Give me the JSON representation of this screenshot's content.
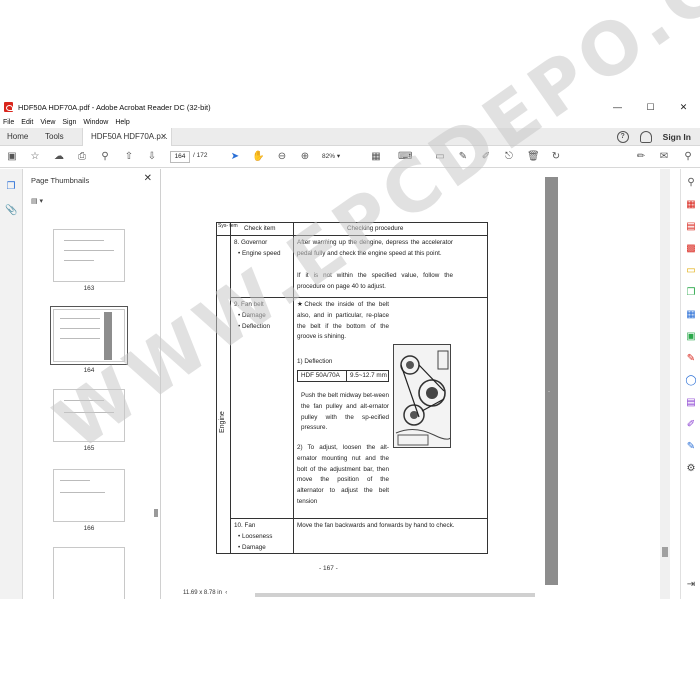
{
  "window": {
    "title": "HDF50A HDF70A.pdf - Adobe Acrobat Reader DC (32-bit)",
    "min": "—",
    "max": "☐",
    "close": "✕"
  },
  "menu": [
    "File",
    "Edit",
    "View",
    "Sign",
    "Window",
    "Help"
  ],
  "tabs": {
    "home": "Home",
    "tools": "Tools",
    "doc": "HDF50A HDF70A.p...",
    "doc_close": "✕",
    "help": "?",
    "signin": "Sign In"
  },
  "toolbar": {
    "page_current": "164",
    "page_total": "/ 172",
    "zoom": "82%"
  },
  "thumbnails": {
    "header": "Page Thumbnails",
    "close": "✕",
    "items": [
      {
        "label": "163"
      },
      {
        "label": "164"
      },
      {
        "label": "165"
      },
      {
        "label": "166"
      }
    ]
  },
  "document": {
    "table": {
      "headers": {
        "system": "Sys-\ntem",
        "check_item": "Check item",
        "procedure": "Checking procedure"
      },
      "system_name": "Engine",
      "rows": [
        {
          "item": "8. Governor",
          "sub": [
            "• Engine speed"
          ],
          "procedure": [
            "After warming up the dengine, depress the accelerator pedal fully and check the engine speed at this point.",
            "If it is not within the specified value, follow the procedure on page 40 to adjust."
          ]
        },
        {
          "item": "9. Fan belt",
          "sub": [
            "• Damage",
            "• Deflection"
          ],
          "procedure": [
            "★Check the inside of the belt also, and in particular, re-place the belt if the bottom of the groove is shining."
          ],
          "deflection_title": "1) Deflection",
          "spec_model": "HDF 50A/70A",
          "spec_value": "9.5~12.7 mm",
          "push_text": "Push the belt midway bet-ween the fan pulley and alt-ernator pulley with the sp-ecified pressure.",
          "adjust_text": "2) To adjust, loosen the alt-ernator mounting nut and the bolt of the adjustment bar, then move the position of the alternator to adjust the belt tension"
        },
        {
          "item": "10. Fan",
          "sub": [
            "• Looseness",
            "• Damage"
          ],
          "procedure": [
            "Move the fan backwards and forwards by hand to check."
          ]
        }
      ]
    },
    "page_number": "- 167 -"
  },
  "status": {
    "size": "11.69 x 8.78 in"
  },
  "watermark": "WWW.EPCDEPO.COM"
}
